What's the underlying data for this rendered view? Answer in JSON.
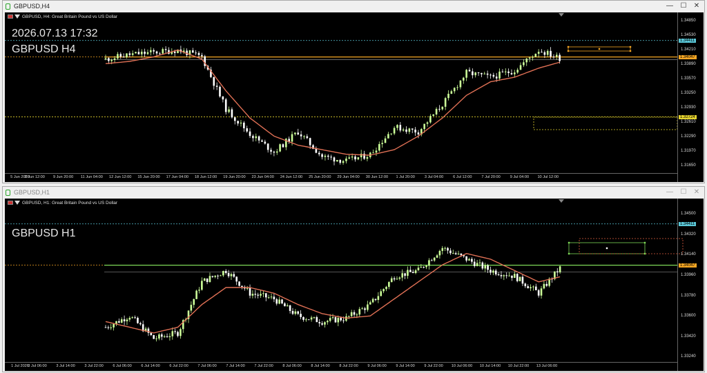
{
  "colors": {
    "bull": "#ccff99",
    "bear": "#ffffff",
    "ma": "#e07055",
    "bid": "#f5a623",
    "support": "#e5d32e",
    "ask": "#aaaaaa",
    "cyan": "#5bc8d8",
    "rect": "#f5a623",
    "green": "#7ed957"
  },
  "w1": {
    "title": "GBPUSD,H4",
    "header": "GBPUSD, H4:  Great Britain Pound vs US Dollar",
    "datetime": "2026.07.13 17:32",
    "label": "GBPUSD H4",
    "price_ticks": [
      "1.34850",
      "1.34530",
      "1.34210",
      "1.33890",
      "1.33570",
      "1.33250",
      "1.32930",
      "1.32610",
      "1.32290",
      "1.31970",
      "1.31650"
    ],
    "tags": {
      "cyan": "1.34411",
      "bid": "1.34047",
      "support": "1.32724"
    },
    "time_ticks": [
      "5 Jun 2026",
      "8 Jun 12:00",
      "9 Jun 20:00",
      "11 Jun 04:00",
      "12 Jun 12:00",
      "15 Jun 20:00",
      "17 Jun 04:00",
      "18 Jun 12:00",
      "19 Jun 20:00",
      "23 Jun 04:00",
      "24 Jun 12:00",
      "25 Jun 20:00",
      "29 Jun 04:00",
      "30 Jun 12:00",
      "1 Jul 20:00",
      "3 Jul 04:00",
      "6 Jul 12:00",
      "7 Jul 20:00",
      "9 Jul 04:00",
      "10 Jul 12:00"
    ]
  },
  "w2": {
    "title": "GBPUSD,H1",
    "header": "GBPUSD, H1:  Great Britain Pound vs US Dollar",
    "label": "GBPUSD H1",
    "price_ticks": [
      "1.34500",
      "1.34320",
      "1.34140",
      "1.33960",
      "1.33780",
      "1.33600",
      "1.33420",
      "1.33240"
    ],
    "tags": {
      "cyan": "1.34411",
      "bid": "1.34047"
    },
    "time_ticks": [
      "1 Jul 2026",
      "3 Jul 06:00",
      "3 Jul 14:00",
      "3 Jul 22:00",
      "6 Jul 06:00",
      "6 Jul 14:00",
      "6 Jul 22:00",
      "7 Jul 06:00",
      "7 Jul 14:00",
      "7 Jul 22:00",
      "8 Jul 06:00",
      "8 Jul 14:00",
      "8 Jul 22:00",
      "9 Jul 06:00",
      "9 Jul 14:00",
      "9 Jul 22:00",
      "10 Jul 06:00",
      "10 Jul 14:00",
      "10 Jul 22:00",
      "13 Jul 06:00"
    ]
  },
  "chart_data": [
    {
      "type": "candlestick",
      "title": "GBPUSD, H4:  Great Britain Pound vs US Dollar",
      "ylim": [
        1.315,
        1.3497
      ],
      "x": [
        "5 Jun 2026",
        "8 Jun 12:00",
        "9 Jun 20:00",
        "11 Jun 04:00",
        "12 Jun 12:00",
        "15 Jun 20:00",
        "17 Jun 04:00",
        "18 Jun 12:00",
        "19 Jun 20:00",
        "23 Jun 04:00",
        "24 Jun 12:00",
        "25 Jun 20:00",
        "29 Jun 04:00",
        "30 Jun 12:00",
        "1 Jul 20:00",
        "3 Jul 04:00",
        "6 Jul 12:00",
        "7 Jul 20:00",
        "9 Jul 04:00",
        "10 Jul 12:00"
      ],
      "close_approx": [
        1.34,
        1.341,
        1.3415,
        1.342,
        1.3405,
        1.329,
        1.3235,
        1.3195,
        1.324,
        1.3185,
        1.3175,
        1.319,
        1.325,
        1.324,
        1.33,
        1.337,
        1.336,
        1.3375,
        1.342,
        1.34
      ],
      "ma_approx": [
        1.339,
        1.3395,
        1.3405,
        1.342,
        1.34,
        1.333,
        1.327,
        1.323,
        1.321,
        1.32,
        1.319,
        1.3188,
        1.32,
        1.323,
        1.327,
        1.332,
        1.335,
        1.336,
        1.338,
        1.3395
      ],
      "levels": {
        "bid": 1.34047,
        "cyan": 1.34411,
        "support": 1.32724
      }
    },
    {
      "type": "candlestick",
      "title": "GBPUSD, H1:  Great Britain Pound vs US Dollar",
      "ylim": [
        1.332,
        1.3461
      ],
      "x": [
        "1 Jul 2026",
        "3 Jul 06:00",
        "3 Jul 14:00",
        "3 Jul 22:00",
        "6 Jul 06:00",
        "6 Jul 14:00",
        "6 Jul 22:00",
        "7 Jul 06:00",
        "7 Jul 14:00",
        "7 Jul 22:00",
        "8 Jul 06:00",
        "8 Jul 14:00",
        "8 Jul 22:00",
        "9 Jul 06:00",
        "9 Jul 14:00",
        "9 Jul 22:00",
        "10 Jul 06:00",
        "10 Jul 14:00",
        "10 Jul 22:00",
        "13 Jul 06:00"
      ],
      "close_approx": [
        1.335,
        1.336,
        1.334,
        1.3345,
        1.339,
        1.34,
        1.338,
        1.3375,
        1.336,
        1.3355,
        1.3358,
        1.337,
        1.3395,
        1.34,
        1.342,
        1.341,
        1.34,
        1.3395,
        1.338,
        1.3405
      ],
      "ma_approx": [
        1.3355,
        1.335,
        1.3345,
        1.335,
        1.337,
        1.3385,
        1.3385,
        1.338,
        1.337,
        1.3362,
        1.3358,
        1.336,
        1.3375,
        1.339,
        1.3405,
        1.3415,
        1.341,
        1.34,
        1.339,
        1.3395
      ],
      "levels": {
        "bid": 1.34047,
        "cyan": 1.34411
      }
    }
  ]
}
